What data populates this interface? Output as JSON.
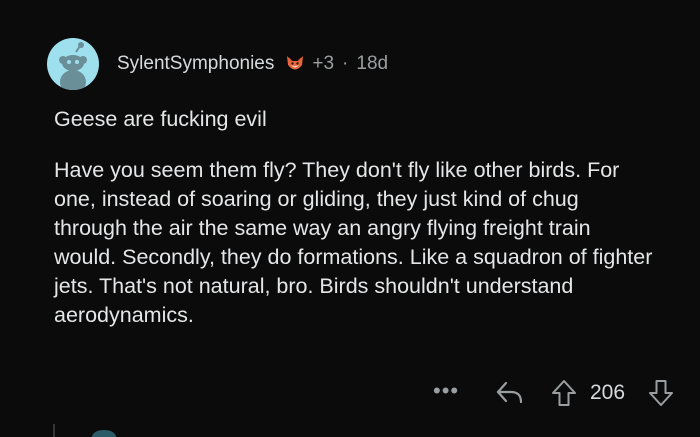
{
  "comment": {
    "username": "SylentSymphonies",
    "flair_icon": "fox-flair-icon",
    "karma": "+3",
    "separator": "·",
    "age": "18d",
    "paragraphs": [
      "Geese are fucking evil",
      "Have you seem them fly? They don't fly like other birds. For one, instead of soaring or gliding, they just kind of chug through the air the same way an angry flying freight train would. Secondly, they do formations. Like a squadron of fighter jets. That's not natural, bro. Birds shouldn't understand aerodynamics."
    ]
  },
  "actions": {
    "more_label": "•••",
    "reply_icon": "reply-icon",
    "upvote_icon": "upvote-icon",
    "score": "206",
    "downvote_icon": "downvote-icon"
  },
  "colors": {
    "background": "#0b0b0b",
    "text": "#e4e6e8",
    "muted": "#9b9ea0",
    "avatar_bg": "#9fe0ef"
  }
}
